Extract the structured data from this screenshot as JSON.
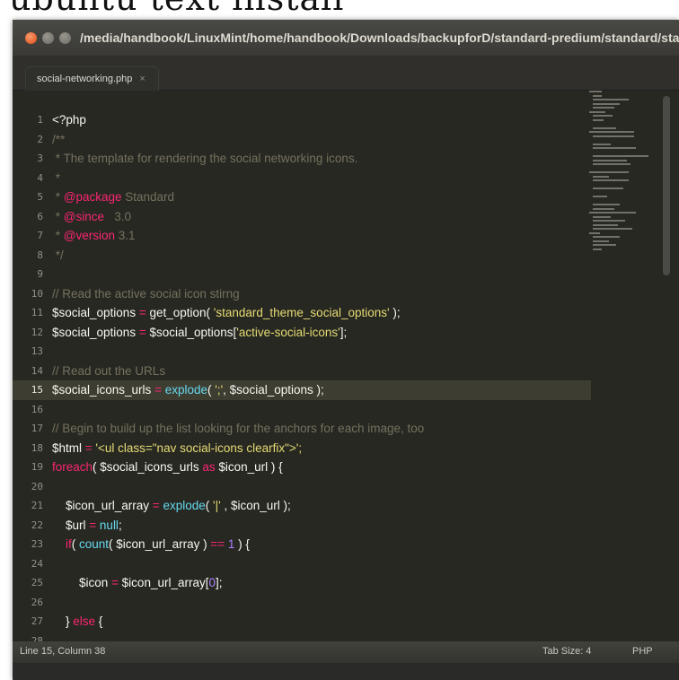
{
  "caption": "ubuntu text install",
  "window": {
    "title": "/media/handbook/LinuxMint/home/handbook/Downloads/backupforD/standard-predium/standard/standard/social-networki"
  },
  "tab": {
    "label": "social-networking.php",
    "close": "×"
  },
  "status": {
    "position": "Line 15, Column 38",
    "tab_size": "Tab Size: 4",
    "syntax": "PHP"
  },
  "current_line": 15,
  "code": [
    [
      {
        "t": "<?php",
        "c": "var"
      }
    ],
    [
      {
        "t": "/**",
        "c": "comment"
      }
    ],
    [
      {
        "t": " * The template for rendering the social networking icons.",
        "c": "comment"
      }
    ],
    [
      {
        "t": " *",
        "c": "comment"
      }
    ],
    [
      {
        "t": " * ",
        "c": "comment"
      },
      {
        "t": "@package",
        "c": "keyword"
      },
      {
        "t": " Standard",
        "c": "comment"
      }
    ],
    [
      {
        "t": " * ",
        "c": "comment"
      },
      {
        "t": "@since",
        "c": "keyword"
      },
      {
        "t": "   3.0",
        "c": "comment"
      }
    ],
    [
      {
        "t": " * ",
        "c": "comment"
      },
      {
        "t": "@version",
        "c": "keyword"
      },
      {
        "t": " 3.1",
        "c": "comment"
      }
    ],
    [
      {
        "t": " */",
        "c": "comment"
      }
    ],
    [
      {
        "t": "",
        "c": "var"
      }
    ],
    [
      {
        "t": "// Read the active social icon stirng",
        "c": "comment"
      }
    ],
    [
      {
        "t": "$social_options ",
        "c": "var"
      },
      {
        "t": "=",
        "c": "keyword"
      },
      {
        "t": " get_option( ",
        "c": "var"
      },
      {
        "t": "'standard_theme_social_options'",
        "c": "string"
      },
      {
        "t": " );",
        "c": "var"
      }
    ],
    [
      {
        "t": "$social_options ",
        "c": "var"
      },
      {
        "t": "=",
        "c": "keyword"
      },
      {
        "t": " $social_options[",
        "c": "var"
      },
      {
        "t": "'active-social-icons'",
        "c": "string"
      },
      {
        "t": "];",
        "c": "var"
      }
    ],
    [
      {
        "t": "",
        "c": "var"
      }
    ],
    [
      {
        "t": "// Read out the URLs",
        "c": "comment"
      }
    ],
    [
      {
        "t": "$social_icons_urls ",
        "c": "var"
      },
      {
        "t": "=",
        "c": "keyword"
      },
      {
        "t": " ",
        "c": "var"
      },
      {
        "t": "explode",
        "c": "func"
      },
      {
        "t": "( ",
        "c": "var"
      },
      {
        "t": "';'",
        "c": "string"
      },
      {
        "t": ", $social_options );",
        "c": "var"
      }
    ],
    [
      {
        "t": "",
        "c": "var"
      }
    ],
    [
      {
        "t": "// Begin to build up the list looking for the anchors for each image, too",
        "c": "comment"
      }
    ],
    [
      {
        "t": "$html ",
        "c": "var"
      },
      {
        "t": "=",
        "c": "keyword"
      },
      {
        "t": " '",
        "c": "string"
      },
      {
        "t": "<ul class=\"nav social-icons clearfix\">",
        "c": "string"
      },
      {
        "t": "';",
        "c": "string"
      }
    ],
    [
      {
        "t": "foreach",
        "c": "keyword"
      },
      {
        "t": "( $social_icons_urls ",
        "c": "var"
      },
      {
        "t": "as",
        "c": "keyword"
      },
      {
        "t": " $icon_url ) {",
        "c": "var"
      }
    ],
    [
      {
        "t": "",
        "c": "var"
      }
    ],
    [
      {
        "t": "    $icon_url_array ",
        "c": "var"
      },
      {
        "t": "=",
        "c": "keyword"
      },
      {
        "t": " ",
        "c": "var"
      },
      {
        "t": "explode",
        "c": "func"
      },
      {
        "t": "( ",
        "c": "var"
      },
      {
        "t": "'|'",
        "c": "string"
      },
      {
        "t": " , $icon_url );",
        "c": "var"
      }
    ],
    [
      {
        "t": "    $url ",
        "c": "var"
      },
      {
        "t": "=",
        "c": "keyword"
      },
      {
        "t": " ",
        "c": "var"
      },
      {
        "t": "null",
        "c": "func"
      },
      {
        "t": ";",
        "c": "var"
      }
    ],
    [
      {
        "t": "    ",
        "c": "var"
      },
      {
        "t": "if",
        "c": "keyword"
      },
      {
        "t": "( ",
        "c": "var"
      },
      {
        "t": "count",
        "c": "func"
      },
      {
        "t": "( $icon_url_array ) ",
        "c": "var"
      },
      {
        "t": "==",
        "c": "keyword"
      },
      {
        "t": " ",
        "c": "var"
      },
      {
        "t": "1",
        "c": "number"
      },
      {
        "t": " ) {",
        "c": "var"
      }
    ],
    [
      {
        "t": "",
        "c": "var"
      }
    ],
    [
      {
        "t": "        $icon ",
        "c": "var"
      },
      {
        "t": "=",
        "c": "keyword"
      },
      {
        "t": " $icon_url_array[",
        "c": "var"
      },
      {
        "t": "0",
        "c": "number"
      },
      {
        "t": "];",
        "c": "var"
      }
    ],
    [
      {
        "t": "",
        "c": "var"
      }
    ],
    [
      {
        "t": "    } ",
        "c": "var"
      },
      {
        "t": "else",
        "c": "keyword"
      },
      {
        "t": " {",
        "c": "var"
      }
    ],
    [
      {
        "t": "",
        "c": "var"
      }
    ]
  ]
}
